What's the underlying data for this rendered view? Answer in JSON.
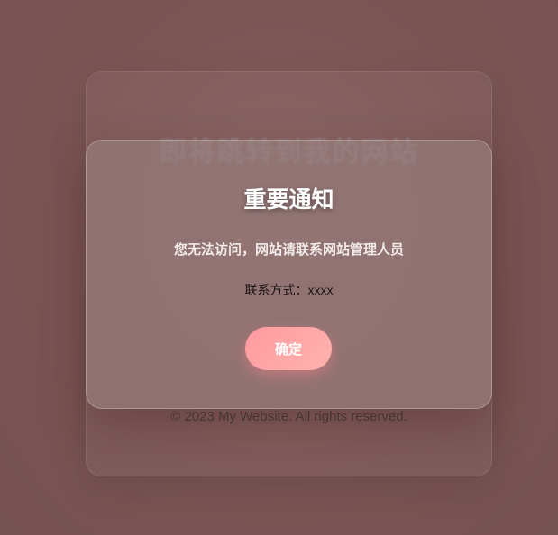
{
  "background_page": {
    "title": "即将跳转到我的网站",
    "footer": "© 2023 My Website. All rights reserved."
  },
  "modal": {
    "title": "重要通知",
    "message": "您无法访问，网站请联系网站管理人员",
    "contact_label": "联系方式：",
    "contact_value": "xxxx",
    "confirm_label": "确定"
  },
  "colors": {
    "page_background": "#7f5a59",
    "modal_background": "#967a7a",
    "button_gradient_start": "#ff9aa0",
    "button_gradient_end": "#ffb3ae",
    "modal_title": "#ffffff"
  }
}
